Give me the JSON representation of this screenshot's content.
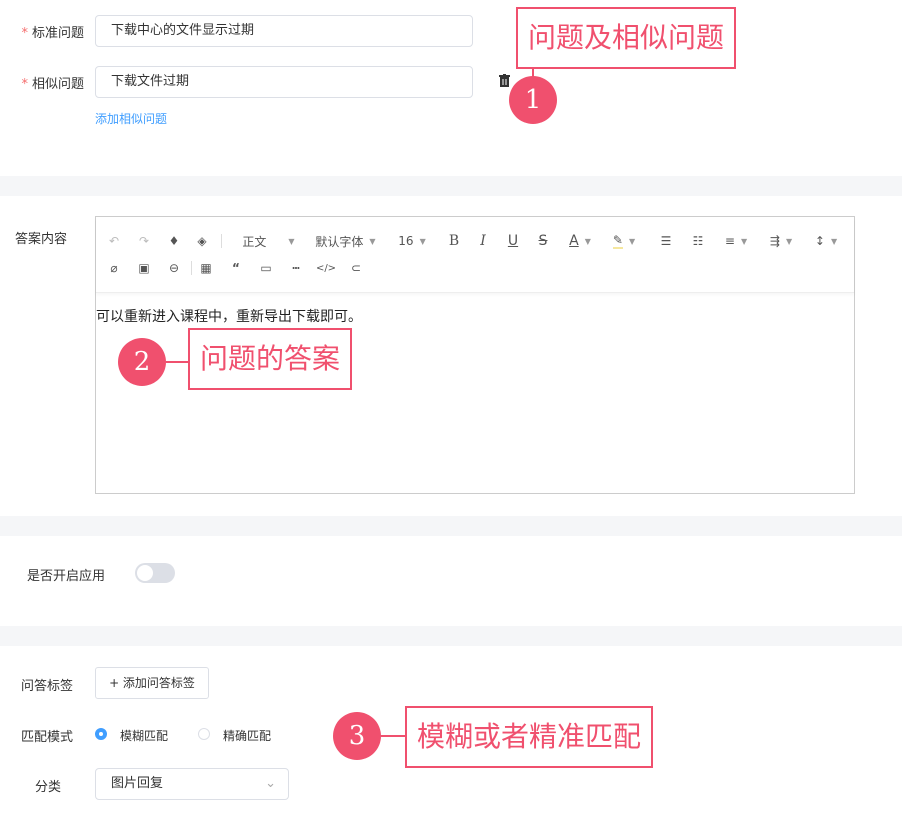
{
  "form": {
    "standard_question": {
      "label": "标准问题",
      "value": "下载中心的文件显示过期"
    },
    "similar_question": {
      "label": "相似问题",
      "value": "下载文件过期",
      "add_link": "添加相似问题"
    },
    "answer": {
      "label": "答案内容",
      "toolbar": {
        "paragraph": "正文",
        "font": "默认字体",
        "size": "16",
        "bold": "B",
        "italic": "I",
        "underline": "U",
        "strike": "S",
        "color": "A"
      },
      "content": "可以重新进入课程中，重新导出下载即可。"
    },
    "enable": {
      "label": "是否开启应用",
      "on": false
    },
    "tags": {
      "label": "问答标签",
      "add_button": "+ 添加问答标签"
    },
    "match_mode": {
      "label": "匹配模式",
      "options": [
        "模糊匹配",
        "精确匹配"
      ],
      "selected": "模糊匹配"
    },
    "category": {
      "label": "分类",
      "value": "图片回复"
    }
  },
  "annotations": [
    {
      "number": "1",
      "text": "问题及相似问题"
    },
    {
      "number": "2",
      "text": "问题的答案"
    },
    {
      "number": "3",
      "text": "模糊或者精准匹配"
    }
  ],
  "colors": {
    "accent": "#409eff",
    "annotation": "#f0506e"
  }
}
